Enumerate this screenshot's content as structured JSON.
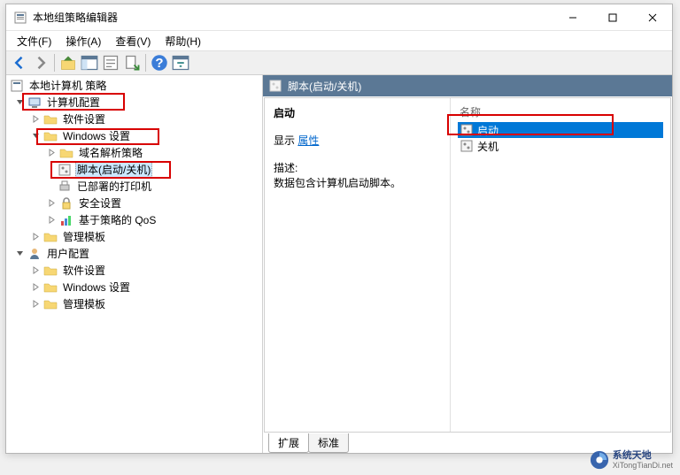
{
  "window": {
    "title": "本地组策略编辑器"
  },
  "menu": {
    "file": "文件(F)",
    "action": "操作(A)",
    "view": "查看(V)",
    "help": "帮助(H)"
  },
  "tree": {
    "root": "本地计算机 策略",
    "computer_config": "计算机配置",
    "software_settings1": "软件设置",
    "windows_settings1": "Windows 设置",
    "dns_policy": "域名解析策略",
    "scripts": "脚本(启动/关机)",
    "printers": "已部署的打印机",
    "security": "安全设置",
    "qos": "基于策略的 QoS",
    "admin_templates1": "管理模板",
    "user_config": "用户配置",
    "software_settings2": "软件设置",
    "windows_settings2": "Windows 设置",
    "admin_templates2": "管理模板"
  },
  "header": {
    "title": "脚本(启动/关机)"
  },
  "detail": {
    "startup_title": "启动",
    "show_label": "显示",
    "properties_link": "属性",
    "desc_label": "描述:",
    "desc_text": "数据包含计算机启动脚本。"
  },
  "list": {
    "column": "名称",
    "items": [
      {
        "label": "启动",
        "selected": true
      },
      {
        "label": "关机",
        "selected": false
      }
    ]
  },
  "tabs": {
    "extended": "扩展",
    "standard": "标准"
  },
  "watermark": {
    "name": "系统天地",
    "url": "XiTongTianDi.net"
  }
}
